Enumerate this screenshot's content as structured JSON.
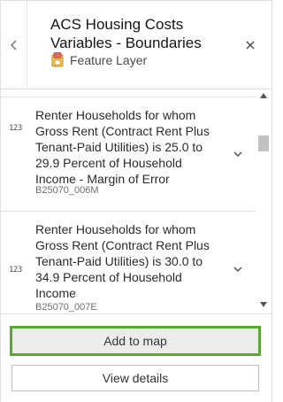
{
  "header": {
    "title": "ACS Housing Costs Variables - Boundaries",
    "subtitle": "Feature Layer"
  },
  "items": [
    {
      "type_icon": "123",
      "label": "Renter Households for whom Gross Rent (Contract Rent Plus Tenant-Paid Utilities) is 25.0 to 29.9 Percent of Household Income - Margin of Error",
      "code": "B25070_006M"
    },
    {
      "type_icon": "123",
      "label": "Renter Households for whom Gross Rent (Contract Rent Plus Tenant-Paid Utilities) is 30.0 to 34.9 Percent of Household Income",
      "code": "B25070_007E"
    }
  ],
  "footer": {
    "add_label": "Add to map",
    "view_label": "View details"
  },
  "colors": {
    "accent_outline": "#5aa831",
    "layer_icon": "#e8b02a"
  },
  "icons": [
    "chevron-left-icon",
    "close-icon",
    "feature-layer-icon",
    "number-type-icon",
    "chevron-down-icon",
    "scroll-up-icon",
    "scroll-down-icon"
  ]
}
